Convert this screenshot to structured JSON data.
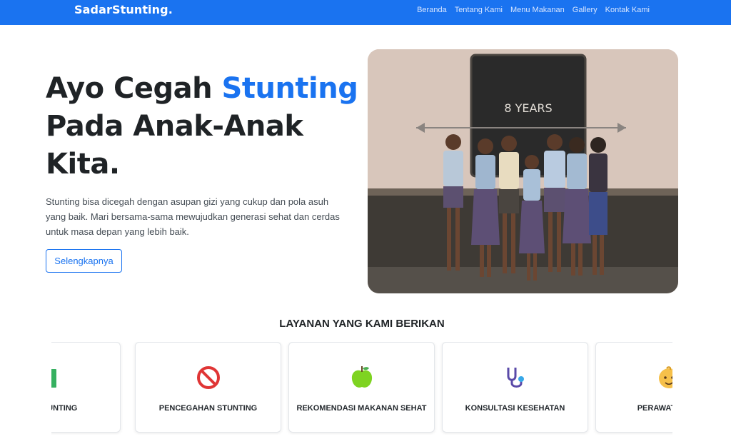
{
  "navbar": {
    "brand": "SadarStunting.",
    "links": [
      "Beranda",
      "Tentang Kami",
      "Menu Makanan",
      "Gallery",
      "Kontak Kami"
    ]
  },
  "hero": {
    "title_part1": "Ayo Cegah ",
    "title_accent": "Stunting",
    "title_line2": "Pada Anak-Anak",
    "title_line3": "Kita.",
    "description": "Stunting bisa dicegah dengan asupan gizi yang cukup dan pola asuh yang baik. Mari bersama-sama mewujudkan generasi sehat dan cerdas untuk masa depan yang lebih baik.",
    "button_label": "Selengkapnya",
    "image_chalk_text": "8 YEARS"
  },
  "services": {
    "title": "LAYANAN YANG KAMI BERIKAN",
    "cards": [
      {
        "label": "ANG STUNTING",
        "icon": "books-icon"
      },
      {
        "label": "PENCEGAHAN STUNTING",
        "icon": "prohibited-icon"
      },
      {
        "label": "REKOMENDASI MAKANAN SEHAT",
        "icon": "green-apple-icon"
      },
      {
        "label": "KONSULTASI KESEHATAN",
        "icon": "stethoscope-icon"
      },
      {
        "label": "PERAWATAN BA",
        "icon": "baby-icon"
      }
    ]
  },
  "colors": {
    "brand_primary": "#1a73f0",
    "heading": "#1f2326",
    "text_muted": "#454d55"
  }
}
